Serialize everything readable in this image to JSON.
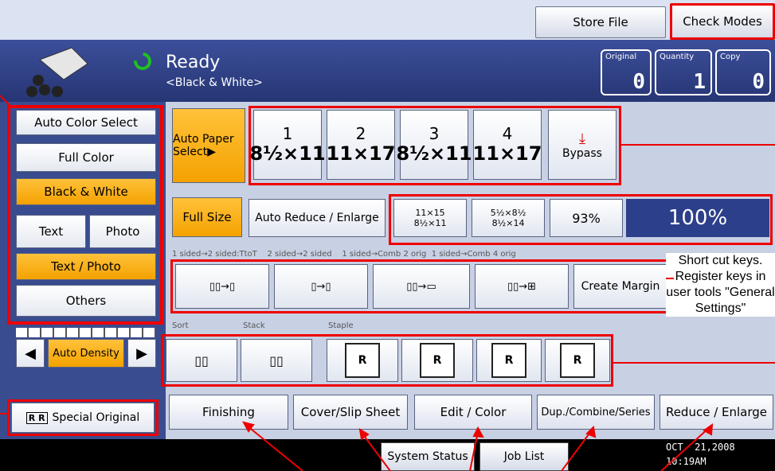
{
  "header": {
    "store_file": "Store File",
    "check_modes": "Check Modes"
  },
  "status": {
    "title": "Ready",
    "subtitle": "<Black & White>"
  },
  "counters": [
    {
      "label": "Original",
      "value": "0"
    },
    {
      "label": "Quantity",
      "value": "1"
    },
    {
      "label": "Copy",
      "value": "0"
    }
  ],
  "color_modes": {
    "auto_color": "Auto Color Select",
    "full_color": "Full Color",
    "black_white": "Black & White",
    "text": "Text",
    "photo": "Photo",
    "text_photo": "Text / Photo",
    "others": "Others",
    "auto_density": "Auto Density",
    "special_original": "Special Original"
  },
  "paper": {
    "auto_paper": "Auto Paper Select▶",
    "trays": [
      {
        "num": "1",
        "size": "8½×11"
      },
      {
        "num": "2",
        "size": "11×17"
      },
      {
        "num": "3",
        "size": "8½×11"
      },
      {
        "num": "4",
        "size": "11×17"
      }
    ],
    "bypass": "Bypass"
  },
  "ratio": {
    "full_size": "Full Size",
    "auto_reduce": "Auto Reduce / Enlarge",
    "shortcut1_top": "11×15",
    "shortcut1_bottom": "8½×11",
    "shortcut2_top": "5½×8½",
    "shortcut2_bottom": "8½×14",
    "percent_small": "93%",
    "percent_big": "100%"
  },
  "duplex": {
    "caption": "1 sided→2 sided:TtoT    2 sided→2 sided    1 sided→Comb 2 orig  1 sided→Comb 4 orig",
    "create_margin": "Create Margin"
  },
  "finish": {
    "sort": "Sort",
    "stack": "Stack",
    "staple": "Staple"
  },
  "tabs": [
    "Finishing",
    "Cover/Slip Sheet",
    "Edit / Color",
    "Dup./Combine/Series",
    "Reduce / Enlarge"
  ],
  "system": {
    "status": "System Status",
    "job_list": "Job List",
    "date": "OCT  21,2008",
    "time": "10:19AM"
  },
  "annotation": "Short cut keys. Register keys in user tools \"General Settings\"",
  "colors": {
    "accent_red": "#ee0000",
    "selected_orange": "#f4a200",
    "panel_blue": "#263574"
  }
}
